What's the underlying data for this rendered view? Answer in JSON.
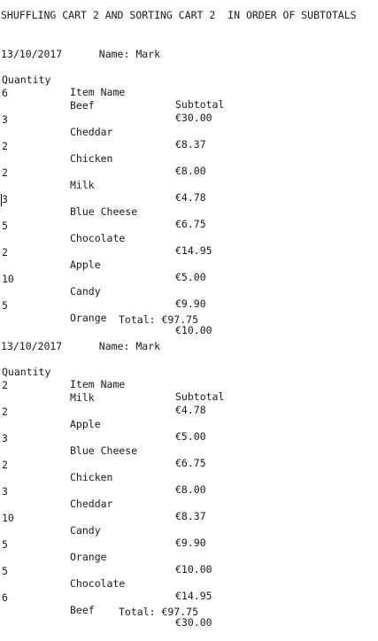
{
  "title": "SHUFFLING CART 2 AND SORTING CART 2  IN ORDER OF SUBTOTALS",
  "headers": {
    "quantity": "Quantity",
    "item": "Item Name",
    "subtotal": "Subtotal"
  },
  "carts": [
    {
      "header_line": "13/10/2017      Name: Mark",
      "rows": [
        {
          "qty": "6",
          "item": "Beef",
          "subtotal": "€30.00"
        },
        {
          "qty": "3",
          "item": "Cheddar",
          "subtotal": "€8.37"
        },
        {
          "qty": "2",
          "item": "Chicken",
          "subtotal": "€8.00"
        },
        {
          "qty": "2",
          "item": "Milk",
          "subtotal": "€4.78"
        },
        {
          "qty": "3",
          "item": "Blue Cheese",
          "subtotal": "€6.75"
        },
        {
          "qty": "5",
          "item": "Chocolate",
          "subtotal": "€14.95"
        },
        {
          "qty": "2",
          "item": "Apple",
          "subtotal": "€5.00"
        },
        {
          "qty": "10",
          "item": "Candy",
          "subtotal": "€9.90"
        },
        {
          "qty": "5",
          "item": "Orange",
          "subtotal": "€10.00"
        }
      ],
      "total": "Total: €97.75"
    },
    {
      "header_line": "13/10/2017      Name: Mark",
      "rows": [
        {
          "qty": "2",
          "item": "Milk",
          "subtotal": "€4.78"
        },
        {
          "qty": "2",
          "item": "Apple",
          "subtotal": "€5.00"
        },
        {
          "qty": "3",
          "item": "Blue Cheese",
          "subtotal": "€6.75"
        },
        {
          "qty": "2",
          "item": "Chicken",
          "subtotal": "€8.00"
        },
        {
          "qty": "3",
          "item": "Cheddar",
          "subtotal": "€8.37"
        },
        {
          "qty": "10",
          "item": "Candy",
          "subtotal": "€9.90"
        },
        {
          "qty": "5",
          "item": "Orange",
          "subtotal": "€10.00"
        },
        {
          "qty": "5",
          "item": "Chocolate",
          "subtotal": "€14.95"
        },
        {
          "qty": "6",
          "item": "Beef",
          "subtotal": "€30.00"
        }
      ],
      "total": "Total: €97.75"
    }
  ]
}
